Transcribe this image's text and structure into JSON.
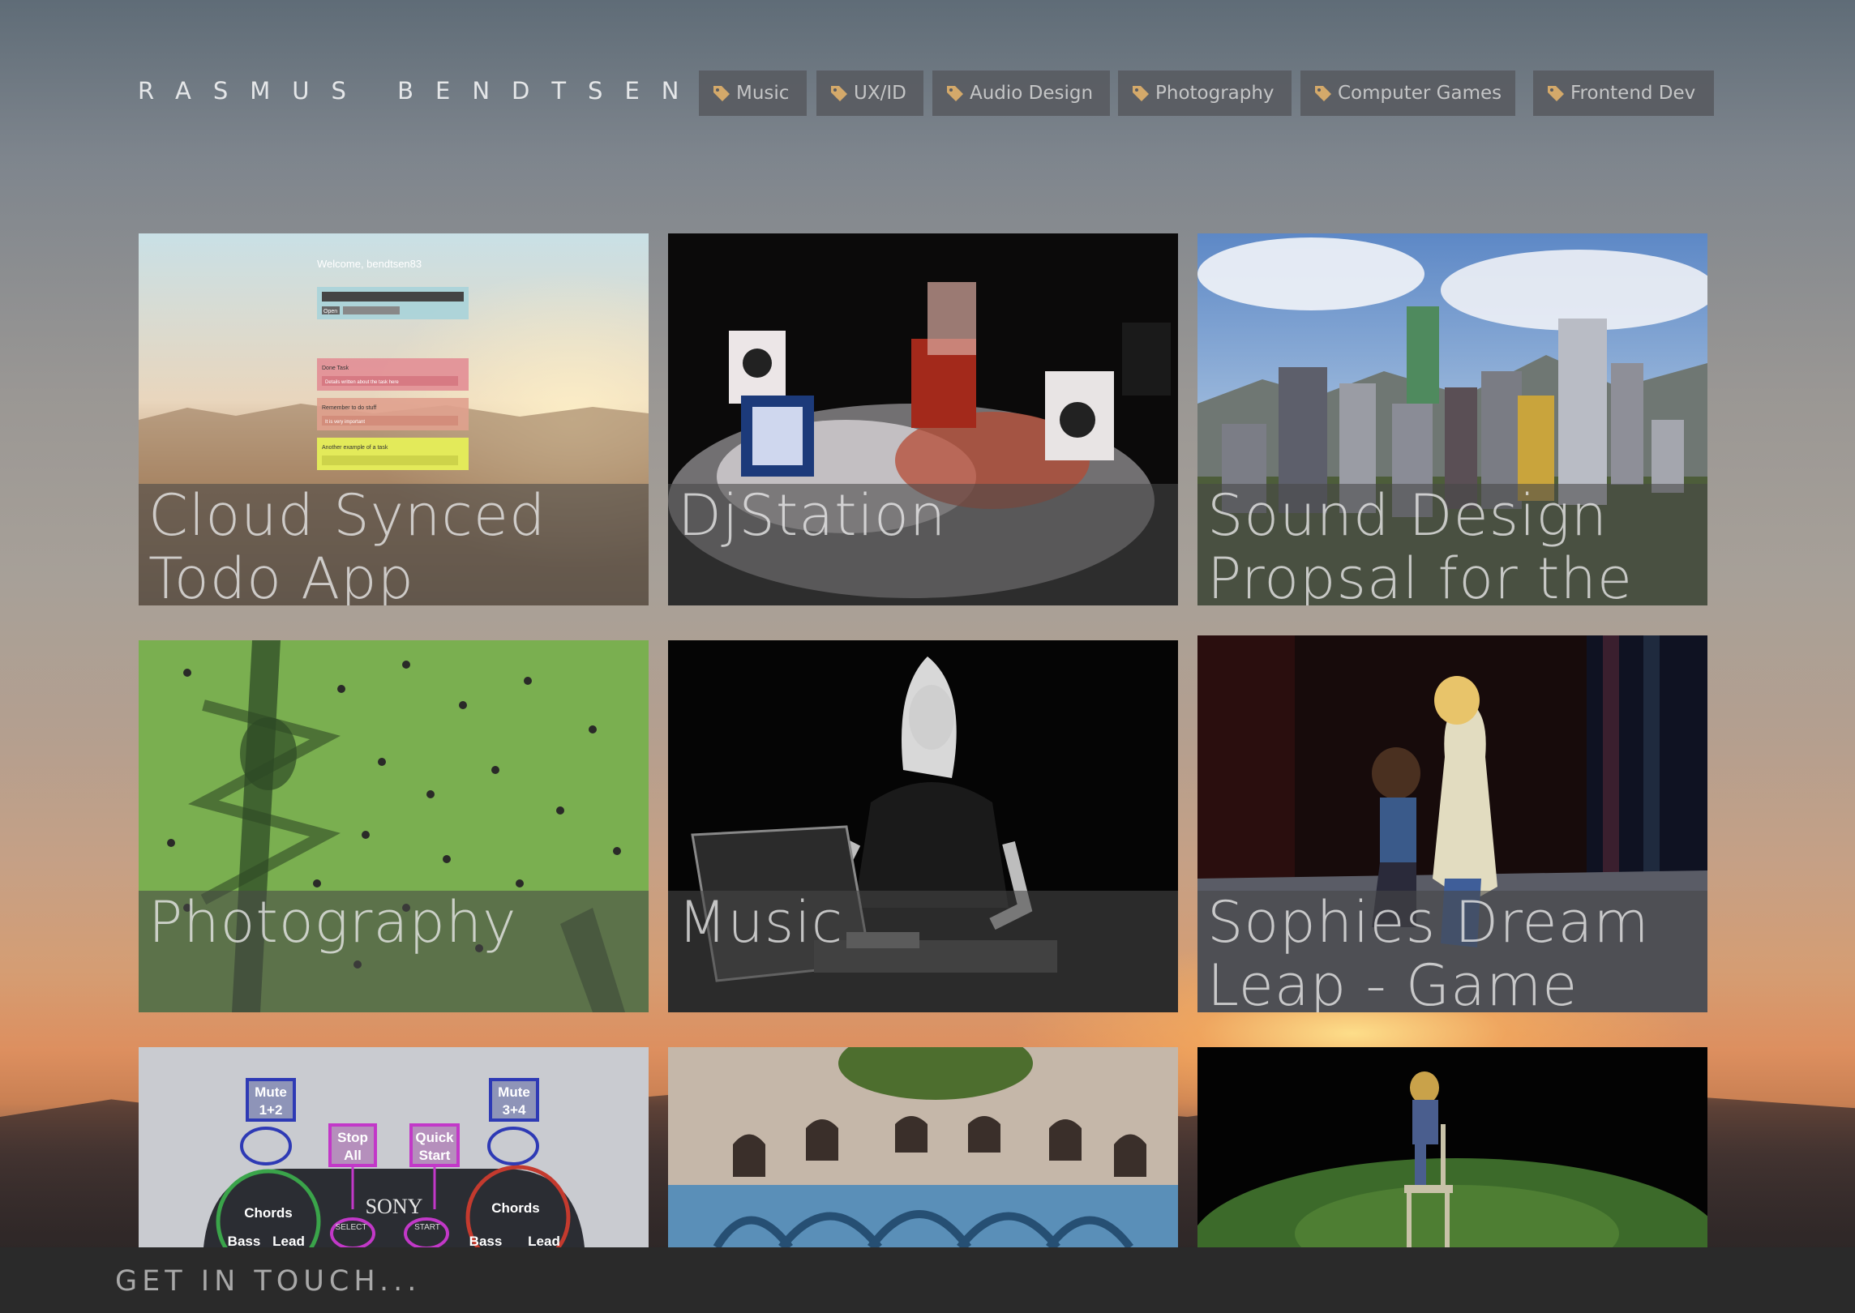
{
  "brand": "RASMUS BENDTSEN",
  "nav": {
    "tags": [
      "Music",
      "UX/ID",
      "Audio Design",
      "Photography",
      "Computer Games",
      "Frontend Dev"
    ],
    "icon": "tag-icon",
    "icon_color": "#d4a96a"
  },
  "projects": [
    {
      "title": "Cloud Synced Todo App",
      "image": "todo-app-screenshot-over-desert"
    },
    {
      "title": "DjStation",
      "image": "hands-moving-marker-cubes"
    },
    {
      "title": "Sound Design Propsal for the",
      "image": "3d-city-skyline"
    },
    {
      "title": "Photography",
      "image": "aerial-park-with-tower-shadow"
    },
    {
      "title": "Music",
      "image": "musician-at-laptop-black-and-white"
    },
    {
      "title": "Sophies Dream Leap - Game",
      "image": "3d-game-characters-on-stage"
    },
    {
      "title": "",
      "image": "gamepad-mapping-diagram"
    },
    {
      "title": "",
      "image": "graffiti-courtyard"
    },
    {
      "title": "",
      "image": "character-on-chair-3d-scene"
    }
  ],
  "gamepad_labels": {
    "mute_left": [
      "Mute",
      "1+2"
    ],
    "mute_right": [
      "Mute",
      "3+4"
    ],
    "stop_all": [
      "Stop",
      "All"
    ],
    "quick_start": [
      "Quick",
      "Start"
    ],
    "brand": "SONY",
    "chords_left": "Chords",
    "chords_right": "Chords",
    "select": "SELECT",
    "start": "START",
    "bass_left": "Bass",
    "lead_left": "Lead",
    "bass_right": "Bass",
    "lead_right": "Lead"
  },
  "todo_preview": {
    "welcome": "Welcome, bendtsen83",
    "open_label": "Open",
    "task1_title": "Done Task",
    "task1_body": "Details written about the task here",
    "task2_title": "Remember to do stuff",
    "task2_body": "It is very important",
    "task3_title": "Another example of a task"
  },
  "footer": {
    "cta": "GET IN TOUCH..."
  }
}
